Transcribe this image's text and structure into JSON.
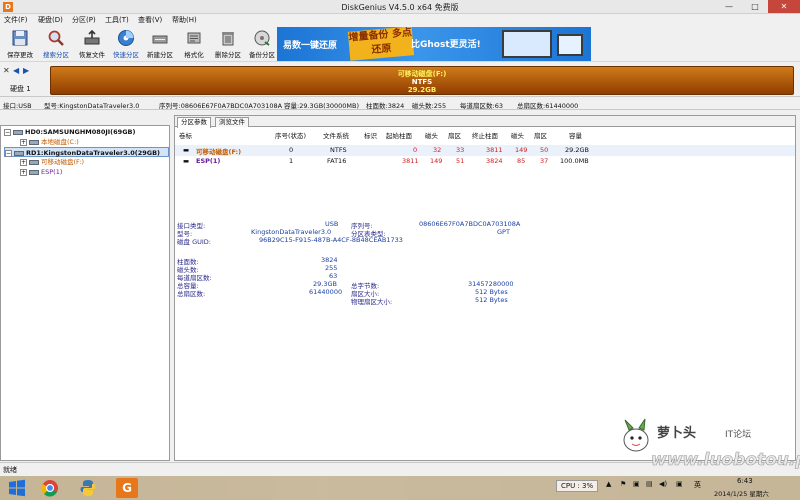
{
  "window": {
    "title": "DiskGenius V4.5.0 x64 免费版",
    "controls": {
      "minimize": "—",
      "maximize": "□",
      "close": "✕"
    }
  },
  "menu": [
    "文件(F)",
    "硬盘(D)",
    "分区(P)",
    "工具(T)",
    "查看(V)",
    "帮助(H)"
  ],
  "toolbar": [
    {
      "label": "保存更改",
      "icon": "save-icon"
    },
    {
      "label": "搜索分区",
      "icon": "search-icon"
    },
    {
      "label": "恢复文件",
      "icon": "recover-icon"
    },
    {
      "label": "快速分区",
      "icon": "quick-partition-icon"
    },
    {
      "label": "新建分区",
      "icon": "new-partition-icon"
    },
    {
      "label": "格式化",
      "icon": "format-icon"
    },
    {
      "label": "删除分区",
      "icon": "delete-icon"
    },
    {
      "label": "备份分区",
      "icon": "backup-icon"
    }
  ],
  "banner": {
    "text1": "易数一键还原",
    "text2": "增量备份 多点还原",
    "text3": "比Ghost更灵活!"
  },
  "diskbar": {
    "disk_label": "硬盘 1",
    "partition_name": "可移动磁盘(F:)",
    "partition_fs": "NTFS",
    "partition_size": "29.2GB",
    "bar_color": "#b35c0c"
  },
  "diskinfo": {
    "interface": "接口:USB",
    "model": "型号:KingstonDataTraveler3.0",
    "serial": "序列号:08606E67F0A7BDC0A703108A",
    "capacity": "容量:29.3GB(30000MB)",
    "cylinders": "柱面数:3824",
    "heads": "磁头数:255",
    "sectors_per_track": "每道扇区数:63",
    "total_sectors": "总扇区数:61440000"
  },
  "tree": {
    "items": [
      {
        "label": "HD0:SAMSUNGHM080JI(69GB)",
        "level": 0,
        "selected": false
      },
      {
        "label": "本地磁盘(C:)",
        "level": 1,
        "selected": false
      },
      {
        "label": "RD1:KingstonDataTraveler3.0(29GB)",
        "level": 0,
        "selected": true
      },
      {
        "label": "可移动磁盘(F:)",
        "level": 1,
        "selected": false
      },
      {
        "label": "ESP(1)",
        "level": 1,
        "selected": false
      }
    ]
  },
  "tabs": [
    "分区参数",
    "浏览文件"
  ],
  "partition_table": {
    "headers": [
      "卷标",
      "序号(状态)",
      "文件系统",
      "标识",
      "起始柱面",
      "磁头",
      "扇区",
      "终止柱面",
      "磁头",
      "扇区",
      "容量"
    ],
    "rows": [
      {
        "label": "可移动磁盘(F:)",
        "index": "0",
        "fs": "NTFS",
        "flag": "",
        "start_cyl": "0",
        "start_head": "32",
        "start_sec": "33",
        "end_cyl": "3811",
        "end_head": "149",
        "end_sec": "50",
        "size": "29.2GB"
      },
      {
        "label": "ESP(1)",
        "index": "1",
        "fs": "FAT16",
        "flag": "",
        "start_cyl": "3811",
        "start_head": "149",
        "start_sec": "51",
        "end_cyl": "3824",
        "end_head": "85",
        "end_sec": "37",
        "size": "100.0MB"
      }
    ]
  },
  "details": {
    "interface_label": "接口类型:",
    "interface_value": "USB",
    "serial_label": "序列号:",
    "serial_value": "08606E67F0A7BDC0A703108A",
    "model_label": "型号:",
    "model_value": "KingstonDataTraveler3.0",
    "pt_label": "分区表类型:",
    "pt_value": "GPT",
    "guid_label": "磁盘 GUID:",
    "guid_value": "96B29C15-F915-487B-A4CF-8B48CEAB1733",
    "cyl_label": "柱面数:",
    "cyl_value": "3824",
    "heads_label": "磁头数:",
    "heads_value": "255",
    "spt_label": "每道扇区数:",
    "spt_value": "63",
    "cap_label": "总容量:",
    "cap_value": "29.3GB",
    "bytes_label": "总字节数:",
    "bytes_value": "31457280000",
    "ts_label": "总扇区数:",
    "ts_value": "61440000",
    "ss_label": "扇区大小:",
    "ss_value": "512 Bytes",
    "pss_label": "物理扇区大小:",
    "pss_value": "512 Bytes"
  },
  "status": "就绪",
  "taskbar": {
    "cpu": "CPU : 3%",
    "lang": "英",
    "time": "6:43",
    "date": "2014/1/25 星期六"
  },
  "watermark": {
    "brand": "萝卜头",
    "suffix": "IT论坛",
    "url": "www.luobotou.pw"
  }
}
